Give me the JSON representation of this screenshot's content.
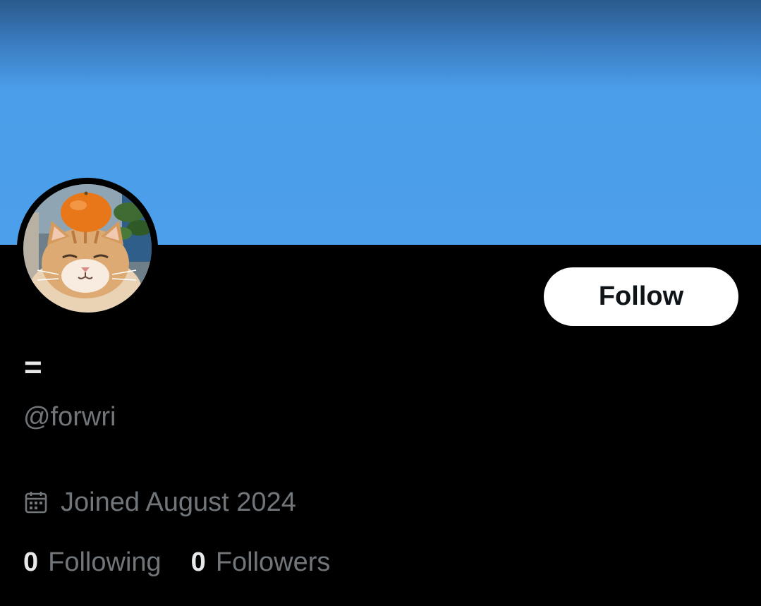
{
  "profile": {
    "display_name": "=",
    "handle": "@forwri",
    "joined": "Joined August 2024",
    "follow_label": "Follow"
  },
  "stats": {
    "following_count": "0",
    "following_label": "Following",
    "followers_count": "0",
    "followers_label": "Followers"
  },
  "icons": {
    "joined": "calendar-icon"
  },
  "colors": {
    "banner": "#4c9fea",
    "background": "#000000",
    "primary_text": "#e7e9ea",
    "secondary_text": "#71767b",
    "follow_button_bg": "#ffffff",
    "follow_button_text": "#0f1419"
  }
}
